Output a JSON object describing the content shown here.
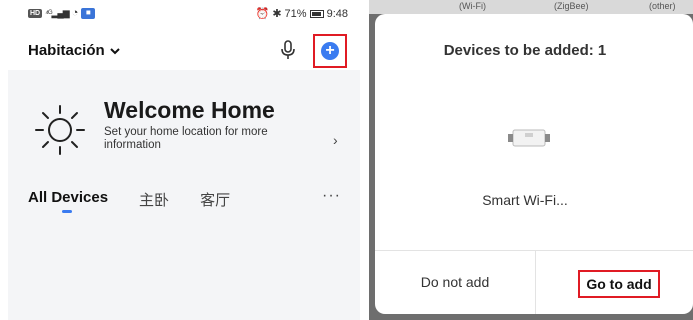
{
  "left": {
    "statusbar": {
      "hd": "HD",
      "signal": "4G",
      "battery_text": "71%",
      "time": "9:48",
      "bt": "✱"
    },
    "room": "Habitación",
    "welcome_title": "Welcome Home",
    "location_prompt": "Set your home location for more information",
    "tabs": [
      "All Devices",
      "主卧",
      "客厅"
    ],
    "more": "···"
  },
  "right": {
    "bg_labels": [
      "(Wi-Fi)",
      "(ZigBee)",
      "(other)"
    ],
    "dialog_title": "Devices to be added: 1",
    "device_name": "Smart Wi-Fi...",
    "btn_no": "Do not add",
    "btn_go": "Go to add"
  },
  "colors": {
    "accent": "#3a7bf0",
    "highlight": "#e01b24"
  }
}
